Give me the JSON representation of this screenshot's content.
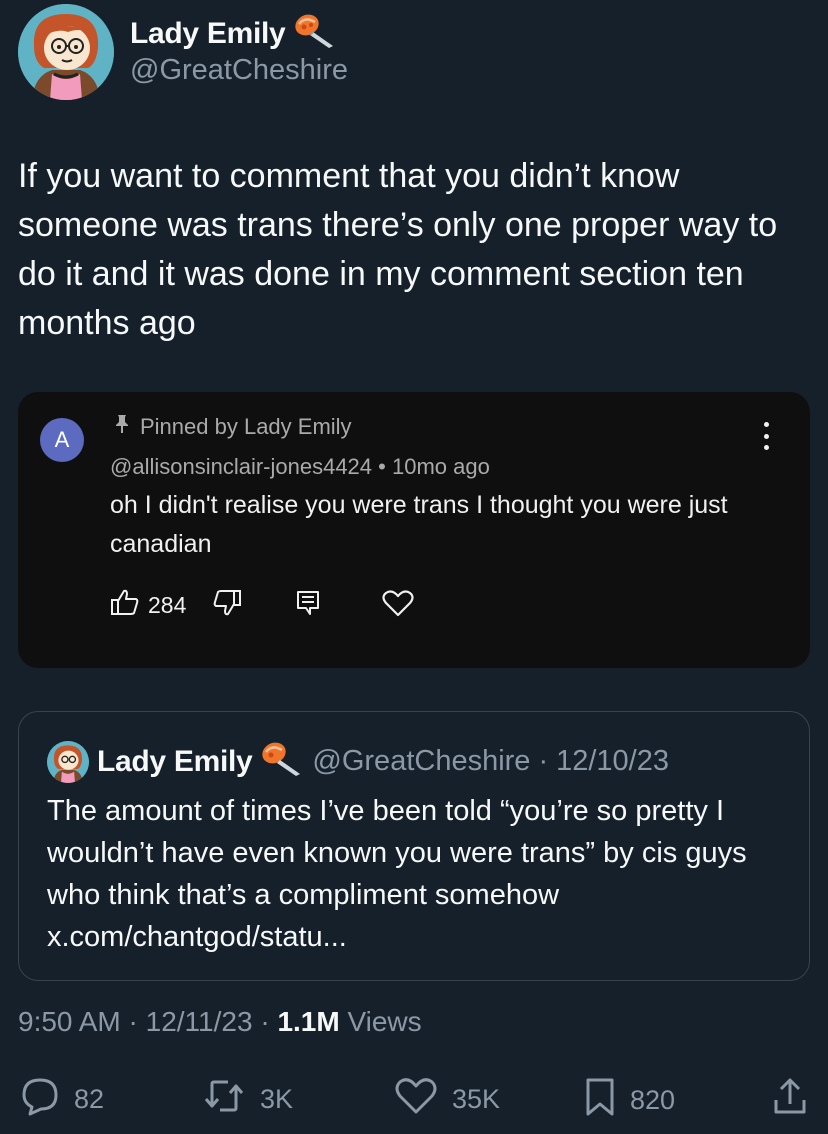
{
  "author": {
    "display_name": "Lady Emily",
    "handle": "@GreatCheshire",
    "badge_icon": "paintbrush-badge-icon"
  },
  "tweet": {
    "text": "If you want to comment that you didn’t know someone was trans there’s only one proper way to do it and it was done in my comment section ten months ago"
  },
  "embedded_comment": {
    "avatar_letter": "A",
    "pinned_label": "Pinned by Lady Emily",
    "author_handle": "@allisonsinclair-jones4424",
    "separator": "•",
    "age": "10mo ago",
    "text": "oh I didn't realise you were trans I thought you were just canadian",
    "like_count": "284"
  },
  "quote": {
    "display_name": "Lady Emily",
    "handle": "@GreatCheshire",
    "separator": "·",
    "date": "12/10/23",
    "text": "The amount of times I’ve been told “you’re so pretty I wouldn’t have even known you were trans” by cis guys who think that’s a compliment somehow x.com/chantgod/statu..."
  },
  "meta": {
    "time": "9:50 AM",
    "sep1": "·",
    "date": "12/11/23",
    "sep2": "·",
    "views_count": "1.1M",
    "views_label": "Views"
  },
  "actions": {
    "replies": "82",
    "reposts": "3K",
    "likes": "35K",
    "bookmarks": "820"
  },
  "colors": {
    "background": "#15202b",
    "text": "#f7f9f9",
    "secondary_text": "#8b98a5",
    "comment_card": "#0f0f0f",
    "comment_avatar": "#5c6bc0",
    "badge": "#f0742a"
  }
}
